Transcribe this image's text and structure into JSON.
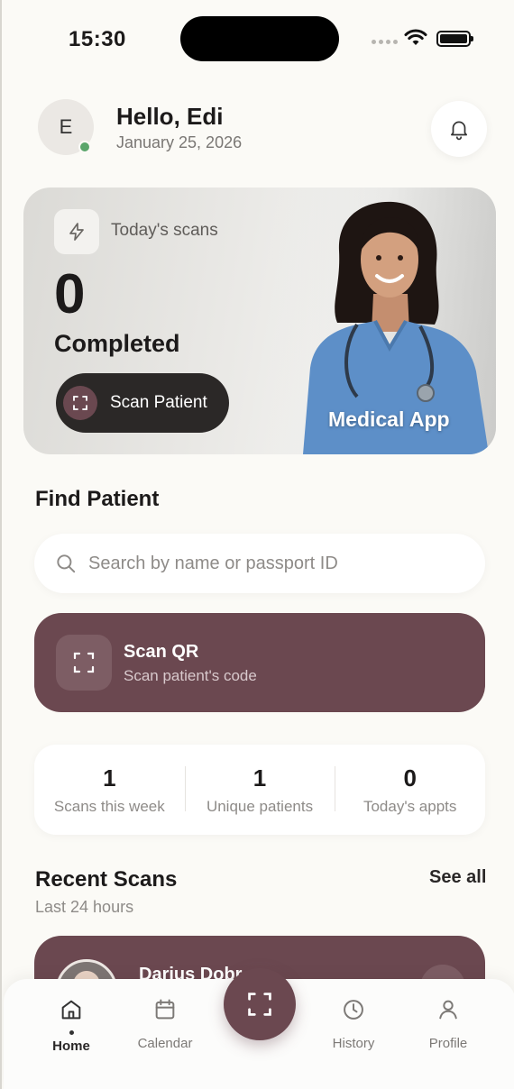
{
  "status_bar": {
    "time": "15:30"
  },
  "header": {
    "avatar_initial": "E",
    "greeting": "Hello, Edi",
    "date": "January 25, 2026"
  },
  "hero": {
    "label": "Today's scans",
    "count": "0",
    "status": "Completed",
    "button_label": "Scan Patient",
    "brand": "Medical App"
  },
  "find_patient": {
    "title": "Find Patient",
    "search_placeholder": "Search by name or passport ID"
  },
  "scan_qr": {
    "title": "Scan QR",
    "subtitle": "Scan patient's code"
  },
  "stats": [
    {
      "value": "1",
      "label": "Scans this week"
    },
    {
      "value": "1",
      "label": "Unique patients"
    },
    {
      "value": "0",
      "label": "Today's appts"
    }
  ],
  "recent": {
    "title": "Recent Scans",
    "subtitle": "Last 24 hours",
    "see_all": "See all",
    "items": [
      {
        "name": "Darius Dobr"
      }
    ]
  },
  "tabbar": {
    "items": [
      {
        "label": "Home",
        "icon": "home-icon",
        "active": true
      },
      {
        "label": "Calendar",
        "icon": "calendar-icon",
        "active": false
      },
      {
        "label": "History",
        "icon": "clock-icon",
        "active": false
      },
      {
        "label": "Profile",
        "icon": "user-icon",
        "active": false
      }
    ],
    "center_icon": "scan-icon"
  },
  "colors": {
    "accent": "#6b4850",
    "background": "#fbfaf6",
    "online": "#5aa56a",
    "dark_button": "#2b2827"
  }
}
